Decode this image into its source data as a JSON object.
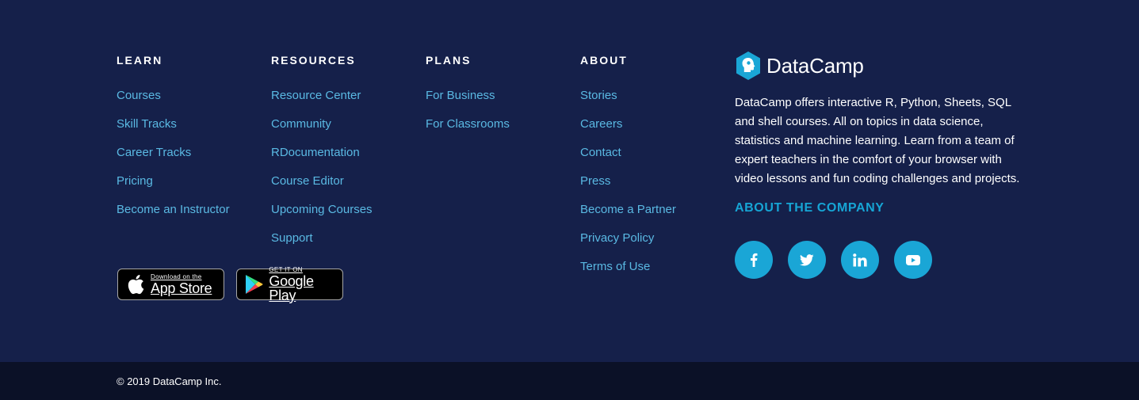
{
  "columns": {
    "learn": {
      "heading": "LEARN",
      "links": [
        "Courses",
        "Skill Tracks",
        "Career Tracks",
        "Pricing",
        "Become an Instructor"
      ]
    },
    "resources": {
      "heading": "RESOURCES",
      "links": [
        "Resource Center",
        "Community",
        "RDocumentation",
        "Course Editor",
        "Upcoming Courses",
        "Support"
      ]
    },
    "plans": {
      "heading": "PLANS",
      "links": [
        "For Business",
        "For Classrooms"
      ]
    },
    "about": {
      "heading": "ABOUT",
      "links": [
        "Stories",
        "Careers",
        "Contact",
        "Press",
        "Become a Partner",
        "Privacy Policy",
        "Terms of Use"
      ]
    }
  },
  "badges": {
    "app_store": {
      "small": "Download on the",
      "big": "App Store",
      "icon": "apple-icon"
    },
    "google_play": {
      "small": "GET IT ON",
      "big": "Google Play",
      "icon": "google-play-icon"
    }
  },
  "brand": {
    "name": "DataCamp",
    "description": "DataCamp offers interactive R, Python, Sheets, SQL and shell courses. All on topics in data science, statistics and machine learning. Learn from a team of expert teachers in the comfort of your browser with video lessons and fun coding challenges and projects.",
    "about_link": "ABOUT THE COMPANY"
  },
  "socials": [
    "facebook-icon",
    "twitter-icon",
    "linkedin-icon",
    "youtube-icon"
  ],
  "copyright": "© 2019 DataCamp Inc.",
  "colors": {
    "background": "#15204a",
    "bottom_bar": "#0b1127",
    "link": "#5ab9e3",
    "accent": "#16a5d5"
  }
}
